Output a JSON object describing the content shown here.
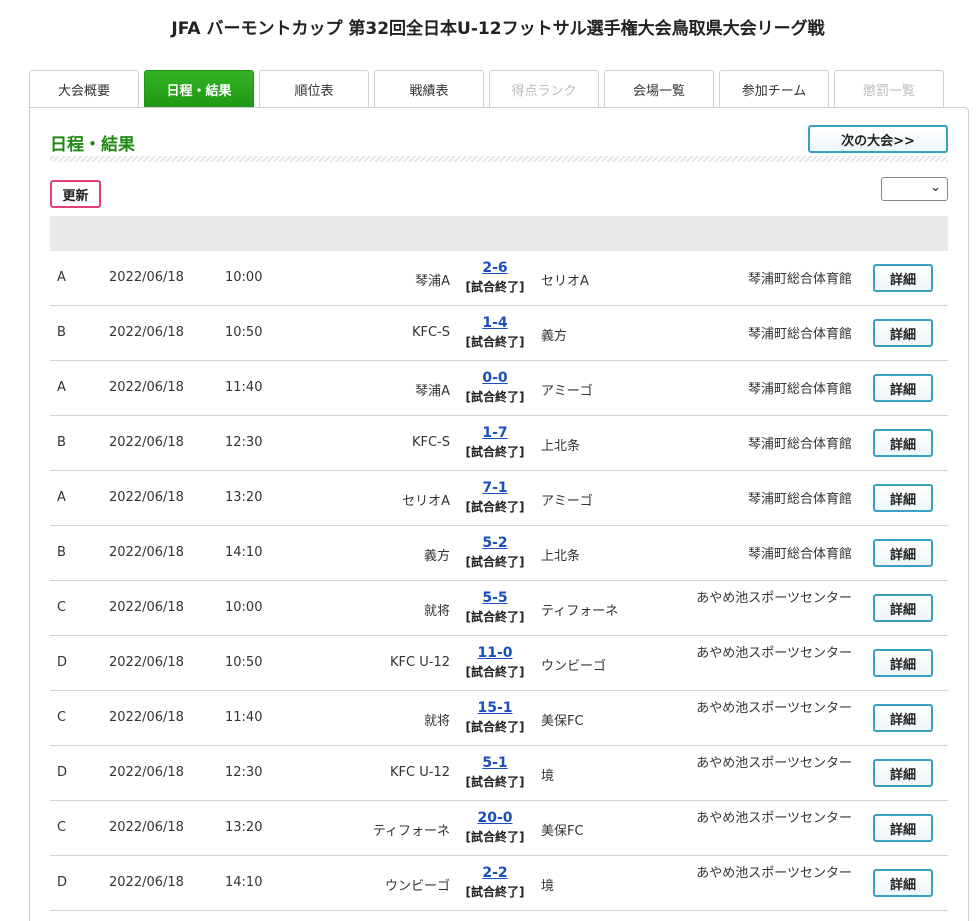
{
  "header": {
    "title": "JFA バーモントカップ 第32回全日本U-12フットサル選手権大会鳥取県大会リーグ戦"
  },
  "tabs": [
    {
      "label": "大会概要",
      "state": "normal"
    },
    {
      "label": "日程・結果",
      "state": "active"
    },
    {
      "label": "順位表",
      "state": "normal"
    },
    {
      "label": "戦績表",
      "state": "normal"
    },
    {
      "label": "得点ランク",
      "state": "disabled"
    },
    {
      "label": "会場一覧",
      "state": "normal"
    },
    {
      "label": "参加チーム",
      "state": "normal"
    },
    {
      "label": "懲罰一覧",
      "state": "disabled"
    }
  ],
  "section": {
    "title": "日程・結果",
    "next_label": "次の大会>>",
    "refresh_label": "更新",
    "select_value": ""
  },
  "matches": [
    {
      "group": "A",
      "date": "2022/06/18",
      "time": "10:00",
      "home": "琴浦A",
      "score": "2-6",
      "status": "[試合終了]",
      "away": "セリオA",
      "venue": "琴浦町総合体育館",
      "detail": "詳細"
    },
    {
      "group": "B",
      "date": "2022/06/18",
      "time": "10:50",
      "home": "KFC-S",
      "score": "1-4",
      "status": "[試合終了]",
      "away": "義方",
      "venue": "琴浦町総合体育館",
      "detail": "詳細"
    },
    {
      "group": "A",
      "date": "2022/06/18",
      "time": "11:40",
      "home": "琴浦A",
      "score": "0-0",
      "status": "[試合終了]",
      "away": "アミーゴ",
      "venue": "琴浦町総合体育館",
      "detail": "詳細"
    },
    {
      "group": "B",
      "date": "2022/06/18",
      "time": "12:30",
      "home": "KFC-S",
      "score": "1-7",
      "status": "[試合終了]",
      "away": "上北条",
      "venue": "琴浦町総合体育館",
      "detail": "詳細"
    },
    {
      "group": "A",
      "date": "2022/06/18",
      "time": "13:20",
      "home": "セリオA",
      "score": "7-1",
      "status": "[試合終了]",
      "away": "アミーゴ",
      "venue": "琴浦町総合体育館",
      "detail": "詳細"
    },
    {
      "group": "B",
      "date": "2022/06/18",
      "time": "14:10",
      "home": "義方",
      "score": "5-2",
      "status": "[試合終了]",
      "away": "上北条",
      "venue": "琴浦町総合体育館",
      "detail": "詳細"
    },
    {
      "group": "C",
      "date": "2022/06/18",
      "time": "10:00",
      "home": "就将",
      "score": "5-5",
      "status": "[試合終了]",
      "away": "ティフォーネ",
      "venue": "あやめ池スポーツセンター",
      "detail": "詳細"
    },
    {
      "group": "D",
      "date": "2022/06/18",
      "time": "10:50",
      "home": "KFC U-12",
      "score": "11-0",
      "status": "[試合終了]",
      "away": "ウンビーゴ",
      "venue": "あやめ池スポーツセンター",
      "detail": "詳細"
    },
    {
      "group": "C",
      "date": "2022/06/18",
      "time": "11:40",
      "home": "就将",
      "score": "15-1",
      "status": "[試合終了]",
      "away": "美保FC",
      "venue": "あやめ池スポーツセンター",
      "detail": "詳細"
    },
    {
      "group": "D",
      "date": "2022/06/18",
      "time": "12:30",
      "home": "KFC U-12",
      "score": "5-1",
      "status": "[試合終了]",
      "away": "境",
      "venue": "あやめ池スポーツセンター",
      "detail": "詳細"
    },
    {
      "group": "C",
      "date": "2022/06/18",
      "time": "13:20",
      "home": "ティフォーネ",
      "score": "20-0",
      "status": "[試合終了]",
      "away": "美保FC",
      "venue": "あやめ池スポーツセンター",
      "detail": "詳細"
    },
    {
      "group": "D",
      "date": "2022/06/18",
      "time": "14:10",
      "home": "ウンビーゴ",
      "score": "2-2",
      "status": "[試合終了]",
      "away": "境",
      "venue": "あやめ池スポーツセンター",
      "detail": "詳細"
    }
  ]
}
